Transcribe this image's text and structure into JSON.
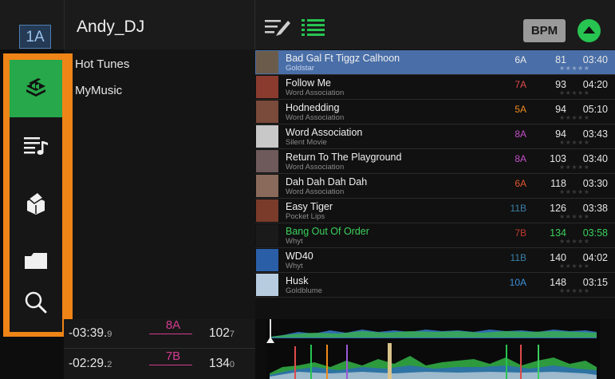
{
  "header": {
    "deck": "1A",
    "title": "Andy_DJ",
    "bpm_label": "BPM"
  },
  "icons": {
    "edit": "edit-list-icon",
    "list": "list-view-icon",
    "sort": "sort-up-icon"
  },
  "sidebar": {
    "items": [
      {
        "name": "collection-icon",
        "active": true
      },
      {
        "name": "playlist-icon",
        "active": false
      },
      {
        "name": "prepare-crate-icon",
        "active": false
      },
      {
        "name": "folder-icon",
        "active": false
      },
      {
        "name": "search-icon",
        "active": false
      }
    ]
  },
  "crates": [
    "Hot Tunes",
    "MyMusic"
  ],
  "tracks": [
    {
      "title": "Bad Gal Ft Tiggz Calhoon",
      "artist": "Goldstar",
      "key": "6A",
      "key_color": "#e8e8e8",
      "bpm": "81",
      "time": "03:40",
      "selected": true
    },
    {
      "title": "Follow Me",
      "artist": "Word Association",
      "key": "7A",
      "key_color": "#e04a4a",
      "bpm": "93",
      "time": "04:20"
    },
    {
      "title": "Hodnedding",
      "artist": "Word Association",
      "key": "5A",
      "key_color": "#f08a1c",
      "bpm": "94",
      "time": "05:10"
    },
    {
      "title": "Word Association",
      "artist": "Silent Movie",
      "key": "8A",
      "key_color": "#c34fc6",
      "bpm": "94",
      "time": "03:43"
    },
    {
      "title": "Return To The Playground",
      "artist": "Word Association",
      "key": "8A",
      "key_color": "#c34fc6",
      "bpm": "103",
      "time": "03:40"
    },
    {
      "title": "Dah Dah Dah Dah",
      "artist": "Word Association",
      "key": "6A",
      "key_color": "#e0572d",
      "bpm": "118",
      "time": "03:30"
    },
    {
      "title": "Easy Tiger",
      "artist": "Pocket Lips",
      "key": "11B",
      "key_color": "#3b7fa8",
      "bpm": "126",
      "time": "03:38"
    },
    {
      "title": "Bang Out Of Order",
      "artist": "Whyt",
      "key": "7B",
      "key_color": "#c0392b",
      "bpm": "134",
      "time": "03:58",
      "played": true
    },
    {
      "title": "WD40",
      "artist": "Whyt",
      "key": "11B",
      "key_color": "#3b7fa8",
      "bpm": "140",
      "time": "04:02"
    },
    {
      "title": "Husk",
      "artist": "Goldblume",
      "key": "10A",
      "key_color": "#3d8fd9",
      "bpm": "148",
      "time": "03:15"
    }
  ],
  "stars": "★★★★★",
  "footer": {
    "deck1": {
      "time": "-03:39.",
      "time_dec": "9",
      "key": "8A",
      "bpm": "102",
      "bpm_dec": "7"
    },
    "deck2": {
      "time": "-02:29.",
      "time_dec": "2",
      "key": "7B",
      "bpm": "134",
      "bpm_dec": "0"
    }
  },
  "colors": {
    "accent": "#ef8417",
    "selected": "#4a6fa8",
    "green": "#27c451",
    "played": "#3ad05c"
  }
}
